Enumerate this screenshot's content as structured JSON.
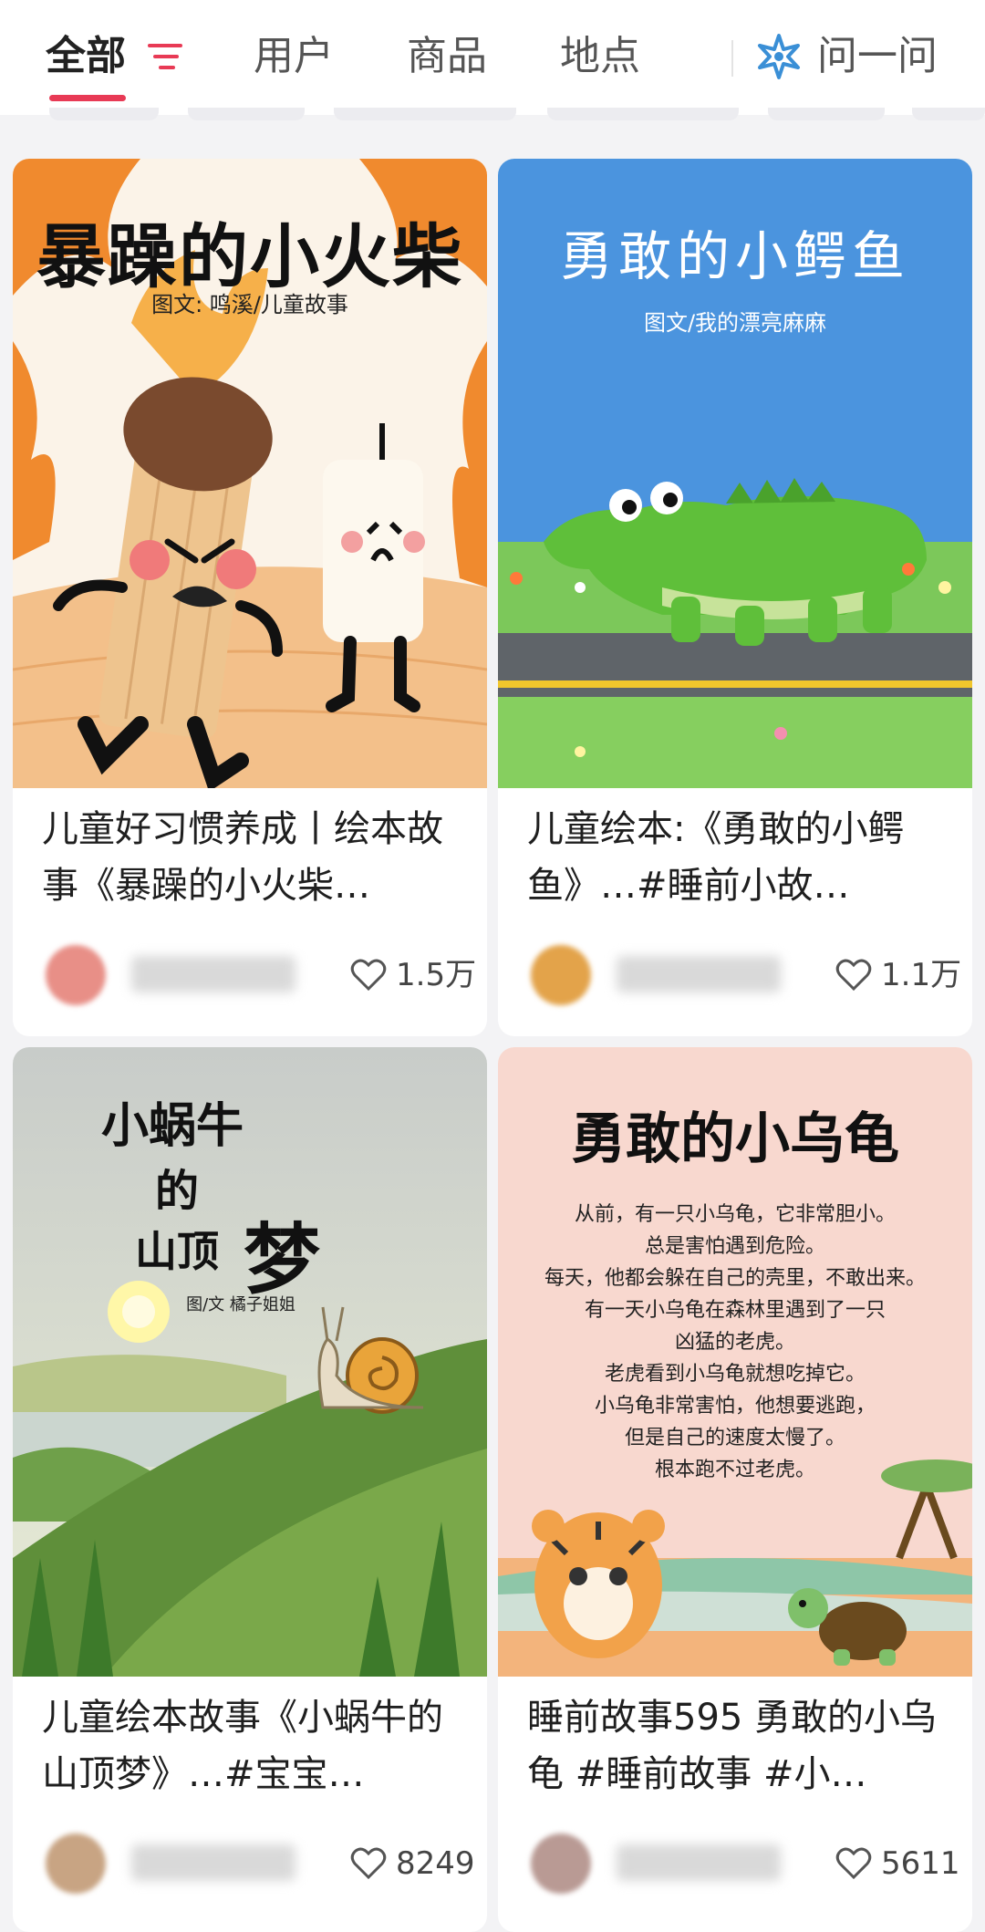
{
  "tabs": {
    "all": "全部",
    "users": "用户",
    "goods": "商品",
    "places": "地点",
    "ask": "问一问"
  },
  "colors": {
    "accent": "#e83a55",
    "ask_icon": "#3a8fd6"
  },
  "cards": [
    {
      "cover_title": "暴躁的小火柴",
      "cover_credit": "图文: 鸣溪/儿童故事",
      "title": "儿童好习惯养成丨绘本故事《暴躁的小火柴…",
      "likes": "1.5万"
    },
    {
      "cover_title": "勇敢的小鳄鱼",
      "cover_credit": "图文/我的漂亮麻麻",
      "title": "儿童绘本:《勇敢的小鳄鱼》…#睡前小故…",
      "likes": "1.1万"
    },
    {
      "cover_title_1": "小蜗牛",
      "cover_title_2": "的",
      "cover_title_3": "山顶",
      "cover_title_4": "梦",
      "cover_credit": "图/文 橘子姐姐",
      "title": "儿童绘本故事《小蜗牛的山顶梦》…#宝宝…",
      "likes": "8249"
    },
    {
      "cover_title": "勇敢的小乌龟",
      "story_lines": [
        "从前，有一只小乌龟，它非常胆小。",
        "总是害怕遇到危险。",
        "每天，他都会躲在自己的壳里，不敢出来。",
        "有一天小乌龟在森林里遇到了一只",
        "凶猛的老虎。",
        "老虎看到小乌龟就想吃掉它。",
        "小乌龟非常害怕，他想要逃跑，",
        "但是自己的速度太慢了。",
        "根本跑不过老虎。"
      ],
      "title": "睡前故事595 勇敢的小乌龟 #睡前故事 #小…",
      "likes": "5611"
    }
  ]
}
